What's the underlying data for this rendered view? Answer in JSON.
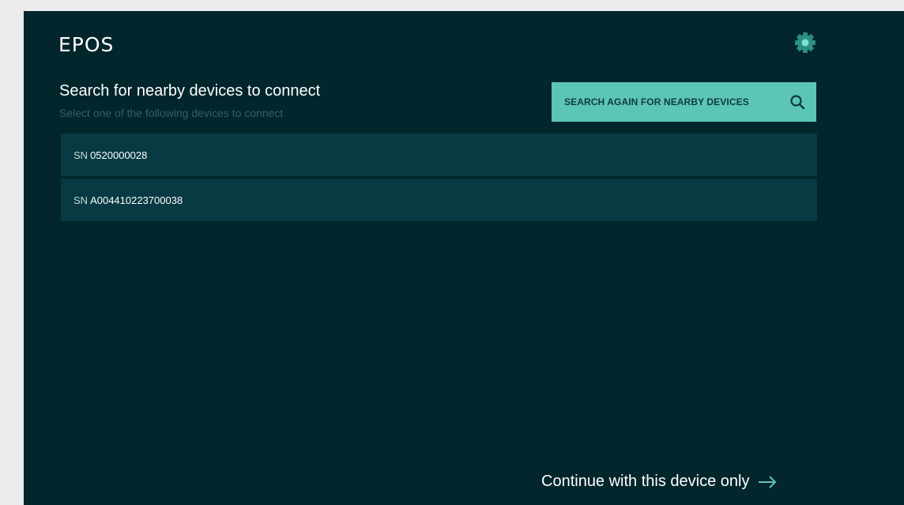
{
  "app": {
    "logo": "EPOS"
  },
  "header": {
    "title": "Search for nearby devices to connect",
    "subtitle": "Select one of the following devices to connect",
    "search_button_label": "SEARCH AGAIN FOR NEARBY DEVICES"
  },
  "devices": [
    {
      "prefix": "SN",
      "serial": "0520000028"
    },
    {
      "prefix": "SN",
      "serial": "A004410223700038"
    }
  ],
  "footer": {
    "continue_label": "Continue with this device only"
  },
  "icons": {
    "settings": "gear-icon",
    "search": "search-icon",
    "continue": "arrow-right-icon"
  },
  "colors": {
    "background": "#02262c",
    "accent": "#5cc5b3",
    "row": "#073a42"
  }
}
